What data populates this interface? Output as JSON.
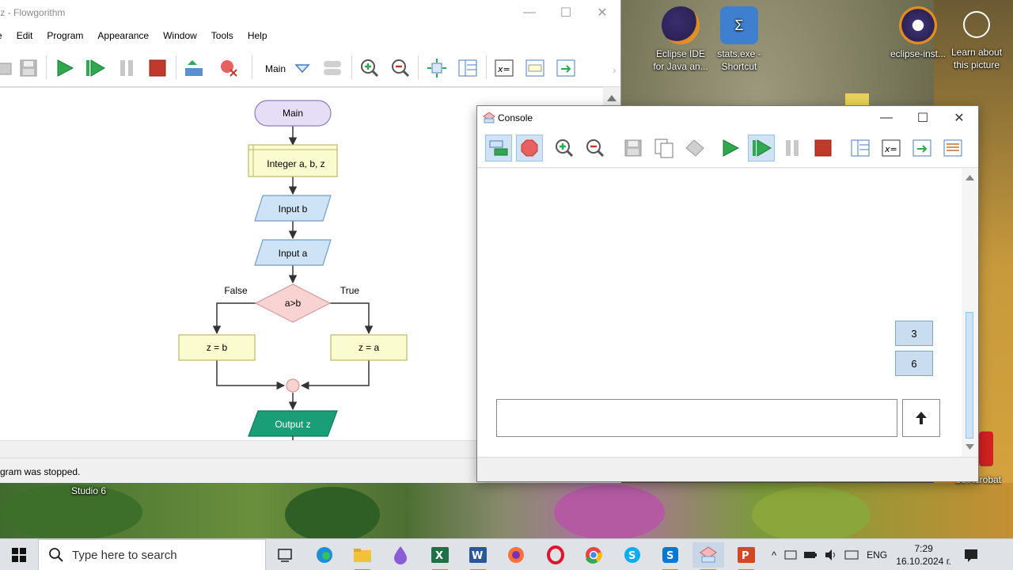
{
  "flowgorithm": {
    "title": "abz - Flowgorithm",
    "title_visible": "abz - Flowgorithm",
    "menu": [
      "e",
      "Edit",
      "Program",
      "Appearance",
      "Window",
      "Tools",
      "Help"
    ],
    "function_select": "Main",
    "status": "gram was stopped.",
    "flowchart": {
      "start": "Main",
      "declare": "Integer a, b, z",
      "input_b": "Input b",
      "input_a": "Input a",
      "decision": "a>b",
      "false_label": "False",
      "true_label": "True",
      "assign_false": "z = b",
      "assign_true": "z = a",
      "output": "Output z"
    }
  },
  "console": {
    "title": "Console",
    "bubbles": [
      "3",
      "6"
    ],
    "input_value": ""
  },
  "desktop": {
    "icons": [
      {
        "label": "Eclipse IDE for Java an...",
        "icon": "eclipse-icon"
      },
      {
        "label": "stats.exe - Shortcut",
        "icon": "stats-icon"
      },
      {
        "label": "eclipse-inst...",
        "icon": "eclipse-installer-icon"
      },
      {
        "label": "Learn about this picture",
        "icon": "camera-icon"
      }
    ],
    "partial_labels": [
      "Studio 6",
      "be Acrobat"
    ]
  },
  "taskbar": {
    "search_placeholder": "Type here to search",
    "language": "ENG",
    "time": "7:29",
    "date": "16.10.2024 г."
  },
  "colors": {
    "terminal": "#e6ddf6",
    "declare": "#fbfbd0",
    "io": "#cfe3f7",
    "decision": "#f9d2d2",
    "output": "#1a9e77",
    "stop_red": "#c0392b",
    "run_green": "#2fa84f"
  }
}
